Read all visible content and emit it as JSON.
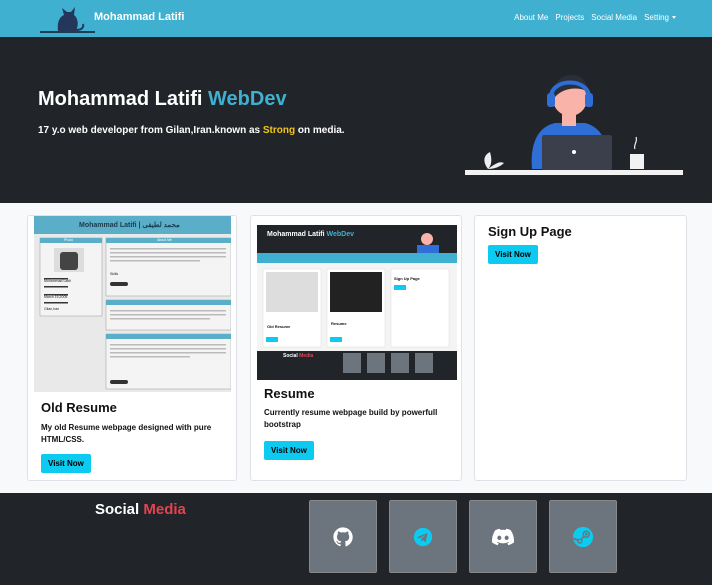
{
  "navbar": {
    "brand": "Mohammad Latifi",
    "links": [
      "About Me",
      "Projects",
      "Social Media",
      "Setting"
    ]
  },
  "hero": {
    "title_main": "Mohammad Latifi ",
    "title_accent": "WebDev",
    "subtitle_pre": "17 y.o web developer from Gilan,Iran.known as ",
    "subtitle_strong": "Strong",
    "subtitle_post": " on media."
  },
  "cards": [
    {
      "title": "Old Resume",
      "text": "My old Resume webpage designed with pure HTML/CSS.",
      "button": "Visit Now"
    },
    {
      "title": "Resume",
      "text": "Currently resume webpage build by powerfull bootstrap",
      "button": "Visit Now"
    },
    {
      "title": "Sign Up Page",
      "button": "Visit Now"
    }
  ],
  "old_resume_preview": {
    "header": "Mohammad Latifi | محمد لطیفی",
    "section_title": "About Me",
    "side_title": "Photo",
    "skills": "Skills",
    "real_name_label": "Real Name:",
    "real_name": "Mohammad Latifi",
    "birthday_label": "Birthday:",
    "birthday": "March 15,2005",
    "location_label": "Location:",
    "location": "Gilan,Iran"
  },
  "resume_preview": {
    "title": "Mohammad Latifi",
    "title_accent": "WebDev",
    "card_title": "Old Resume",
    "card2_title": "Resume",
    "card3_title": "Sign Up Page",
    "social": "Social",
    "social_accent": "Media"
  },
  "footer": {
    "title": "Social",
    "title_accent": "Media",
    "socials": [
      "github-icon",
      "telegram-icon",
      "discord-icon",
      "steam-icon"
    ]
  },
  "colors": {
    "primary": "#3fb0cf",
    "dark": "#212529",
    "info_button": "#0dcaf0",
    "strong": "#f5c518",
    "red": "#e34350"
  }
}
